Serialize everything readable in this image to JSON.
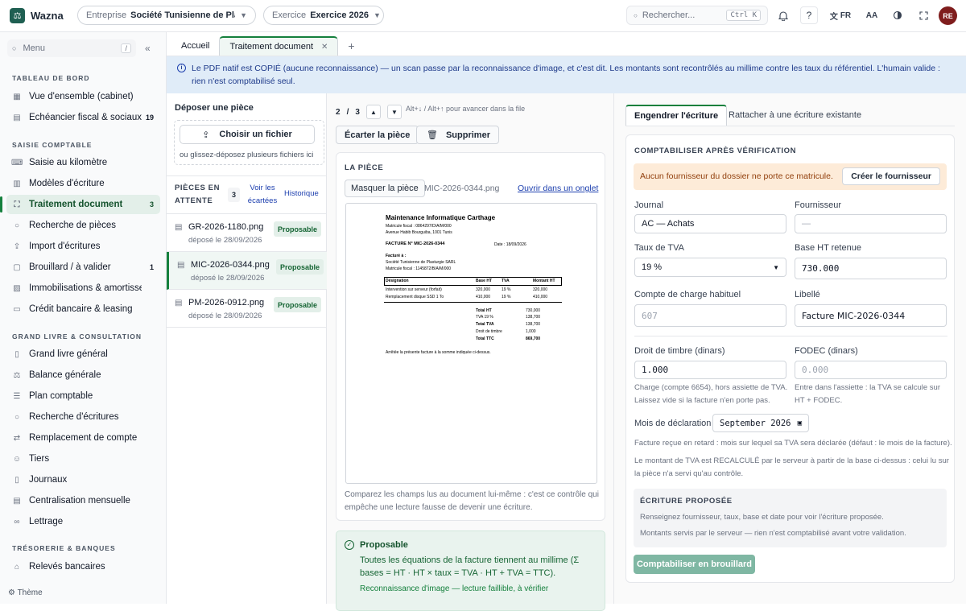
{
  "app": {
    "name": "Wazna",
    "logo_glyph": "⚖"
  },
  "topbar": {
    "entreprise_label": "Entreprise",
    "entreprise_value": "Société Tunisienne de Pla...",
    "exercice_label": "Exercice",
    "exercice_value": "Exercice 2026",
    "search_placeholder": "Rechercher...",
    "search_shortcut": "Ctrl K",
    "help": "?",
    "lang": "FR",
    "font_size": "AA",
    "user_initials": "RE"
  },
  "sidebar": {
    "menu_placeholder": "Menu",
    "menu_shortcut": "/",
    "sections": [
      {
        "title": "Tableau de bord",
        "items": [
          {
            "label": "Vue d'ensemble (cabinet)",
            "count": ""
          },
          {
            "label": "Échéancier fiscal & sociaux",
            "count": "19"
          }
        ]
      },
      {
        "title": "Saisie comptable",
        "items": [
          {
            "label": "Saisie au kilomètre",
            "count": ""
          },
          {
            "label": "Modèles d'écriture",
            "count": ""
          },
          {
            "label": "Traitement document",
            "count": "3"
          },
          {
            "label": "Recherche de pièces",
            "count": ""
          },
          {
            "label": "Import d'écritures",
            "count": ""
          },
          {
            "label": "Brouillard / à valider",
            "count": "1"
          },
          {
            "label": "Immobilisations & amortissements",
            "count": ""
          },
          {
            "label": "Crédit bancaire & leasing",
            "count": ""
          }
        ]
      },
      {
        "title": "Grand livre & consultation",
        "items": [
          {
            "label": "Grand livre général",
            "count": ""
          },
          {
            "label": "Balance générale",
            "count": ""
          },
          {
            "label": "Plan comptable",
            "count": ""
          },
          {
            "label": "Recherche d'écritures",
            "count": ""
          },
          {
            "label": "Remplacement de compte",
            "count": ""
          },
          {
            "label": "Tiers",
            "count": ""
          },
          {
            "label": "Journaux",
            "count": ""
          },
          {
            "label": "Centralisation mensuelle",
            "count": ""
          },
          {
            "label": "Lettrage",
            "count": ""
          }
        ]
      },
      {
        "title": "Trésorerie & banques",
        "items": [
          {
            "label": "Relevés bancaires",
            "count": ""
          }
        ]
      }
    ],
    "theme_label": "Thème"
  },
  "tabs": [
    {
      "label": "Accueil"
    },
    {
      "label": "Traitement document"
    }
  ],
  "banner": "Le PDF natif est COPIÉ (aucune reconnaissance) — un scan passe par la reconnaissance d'image, et c'est dit. Les montants sont recontrôlés au millime contre les taux du référentiel. L'humain valide : rien n'est comptabilisé seul.",
  "upload": {
    "title": "Déposer une pièce",
    "button": "Choisir un fichier",
    "hint": "ou glissez-déposez plusieurs fichiers ici",
    "pending_label": "Pièces en attente",
    "pending_count": "3",
    "discarded_link": "Voir les écartées",
    "history_link": "Historique",
    "files": [
      {
        "name": "GR-2026-1180.png",
        "date": "déposé le 28/09/2026",
        "status": "Proposable"
      },
      {
        "name": "MIC-2026-0344.png",
        "date": "déposé le 28/09/2026",
        "status": "Proposable"
      },
      {
        "name": "PM-2026-0912.png",
        "date": "déposé le 28/09/2026",
        "status": "Proposable"
      }
    ]
  },
  "viewer": {
    "page": "2",
    "sep": "/",
    "total": "3",
    "nav_hint": "Alt+↓ / Alt+↑ pour avancer dans la file",
    "discard": "Écarter la pièce",
    "delete": "Supprimer",
    "piece_title": "La pièce",
    "hide": "Masquer la pièce",
    "filename": "MIC-2026-0344.png",
    "open_tab": "Ouvrir dans un onglet",
    "compare_note": "Comparez les champs lus au document lui-même : c'est ce contrôle qui empêche une lecture fausse de devenir une écriture.",
    "status_title": "Proposable",
    "status_text": "Toutes les équations de la facture tiennent au millime (Σ bases = HT · HT × taux = TVA · HT + TVA = TTC).",
    "status_note": "Reconnaissance d'image — lecture faillible, à vérifier"
  },
  "invoice": {
    "company": "Maintenance Informatique Carthage",
    "mf": "Matricule fiscal : 0864297/D/A/M/000",
    "addr": "Avenue Habib Bourguiba, 1001 Tunis",
    "no": "FACTURE N° MIC-2026-0344",
    "date": "Date : 18/09/2026",
    "billed": "Facturé à :",
    "client": "Société Tunisienne de Plasturgie SARL",
    "client_mf": "Matricule fiscal : 1145872/B/A/M/000",
    "headers": [
      "Désignation",
      "Base HT",
      "TVA",
      "Montant HT"
    ],
    "rows": [
      [
        "Intervention sur serveur (forfait)",
        "320,000",
        "19 %",
        "320,000"
      ],
      [
        "Remplacement disque SSD 1 To",
        "410,000",
        "19 %",
        "410,000"
      ]
    ],
    "totals": [
      [
        "Total HT",
        "730,000"
      ],
      [
        "TVA 19 %",
        "138,700"
      ],
      [
        "Total TVA",
        "138,700"
      ],
      [
        "Droit de timbre",
        "1,000"
      ],
      [
        "Total TTC",
        "869,700"
      ]
    ],
    "footer": "Arrêtée la présente facture à la somme indiquée ci-dessus."
  },
  "form": {
    "tab_create": "Engendrer l'écriture",
    "tab_attach": "Rattacher à une écriture existante",
    "section": "Comptabiliser après vérification",
    "warning": "Aucun fournisseur du dossier ne porte ce matricule.",
    "create_supplier": "Créer le fournisseur",
    "journal_label": "Journal",
    "journal_value": "AC — Achats",
    "supplier_label": "Fournisseur",
    "supplier_value": "—",
    "tva_label": "Taux de TVA",
    "tva_value": "19 %",
    "base_label": "Base HT retenue",
    "base_value": "730.000",
    "account_label": "Compte de charge habituel",
    "account_placeholder": "607",
    "libelle_label": "Libellé",
    "libelle_value": "Facture MIC-2026-0344",
    "stamp_label": "Droit de timbre (dinars)",
    "stamp_value": "1.000",
    "fodec_label": "FODEC (dinars)",
    "fodec_placeholder": "0.000",
    "stamp_note": "Charge (compte 6654), hors assiette de TVA. Laissez vide si la facture n'en porte pas.",
    "fodec_note": "Entre dans l'assiette : la TVA se calcule sur HT + FODEC.",
    "month_label": "Mois de déclaration",
    "month_value": "September 2026",
    "month_note": "Facture reçue en retard : mois sur lequel sa TVA sera déclarée (défaut : le mois de la facture).",
    "recalc_note": "Le montant de TVA est RECALCULÉ par le serveur à partir de la base ci-dessus : celui lu sur la pièce n'a servi qu'au contrôle.",
    "proposed_title": "Écriture proposée",
    "proposed_1": "Renseignez fournisseur, taux, base et date pour voir l'écriture proposée.",
    "proposed_2": "Montants servis par le serveur — rien n'est comptabilisé avant votre validation.",
    "submit": "Comptabiliser en brouillard"
  }
}
